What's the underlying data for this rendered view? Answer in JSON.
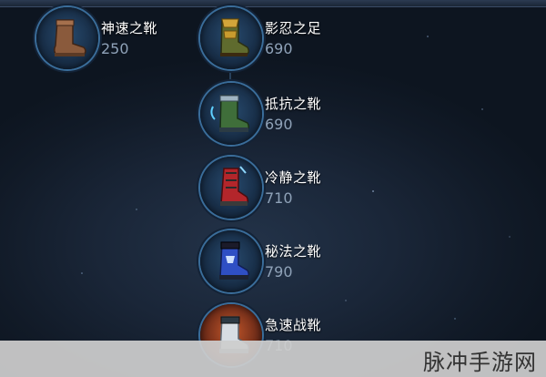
{
  "items": [
    {
      "name": "神速之靴",
      "price": "250",
      "icon": "brown-boot-icon"
    },
    {
      "name": "影忍之足",
      "price": "690",
      "icon": "gold-ninja-boot-icon"
    },
    {
      "name": "抵抗之靴",
      "price": "690",
      "icon": "green-resistance-boot-icon"
    },
    {
      "name": "冷静之靴",
      "price": "710",
      "icon": "red-calm-boot-icon"
    },
    {
      "name": "秘法之靴",
      "price": "790",
      "icon": "blue-arcane-boot-icon"
    },
    {
      "name": "急速战靴",
      "price": "710",
      "icon": "silver-swift-boot-icon"
    }
  ],
  "watermark": "脉冲手游网"
}
